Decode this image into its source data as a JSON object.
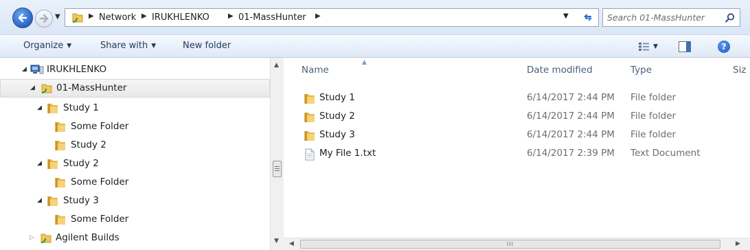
{
  "address_bar": {
    "breadcrumbs": [
      "Network",
      "IRUKHLENKO",
      "01-MassHunter"
    ],
    "search_placeholder": "Search 01-MassHunter"
  },
  "toolbar": {
    "organize_label": "Organize",
    "share_with_label": "Share with",
    "new_folder_label": "New folder"
  },
  "nav_tree": [
    {
      "label": "IRUKHLENKO",
      "level": 0,
      "icon": "network-computer-icon",
      "state": "expanded"
    },
    {
      "label": "01-MassHunter",
      "level": 1,
      "icon": "folder-shortcut-icon",
      "state": "expanded",
      "selected": true
    },
    {
      "label": "Study 1",
      "level": 2,
      "icon": "folder-icon",
      "state": "expanded"
    },
    {
      "label": "Some Folder",
      "level": 3,
      "icon": "folder-icon",
      "state": "none"
    },
    {
      "label": "Study 2",
      "level": 3,
      "icon": "folder-icon",
      "state": "none"
    },
    {
      "label": "Study 2",
      "level": 2,
      "icon": "folder-icon",
      "state": "expanded"
    },
    {
      "label": "Some Folder",
      "level": 3,
      "icon": "folder-icon",
      "state": "none"
    },
    {
      "label": "Study 3",
      "level": 2,
      "icon": "folder-icon",
      "state": "expanded"
    },
    {
      "label": "Some Folder",
      "level": 3,
      "icon": "folder-icon",
      "state": "none"
    },
    {
      "label": "Agilent Builds",
      "level": 1,
      "icon": "folder-shortcut-icon",
      "state": "collapsed"
    }
  ],
  "content": {
    "columns": {
      "name": "Name",
      "date_modified": "Date modified",
      "type": "Type",
      "size": "Siz"
    },
    "files": [
      {
        "name": "Study 1",
        "date": "6/14/2017 2:44 PM",
        "type": "File folder",
        "icon": "folder-icon"
      },
      {
        "name": "Study 2",
        "date": "6/14/2017 2:44 PM",
        "type": "File folder",
        "icon": "folder-icon"
      },
      {
        "name": "Study 3",
        "date": "6/14/2017 2:44 PM",
        "type": "File folder",
        "icon": "folder-icon"
      },
      {
        "name": "My File 1.txt",
        "date": "6/14/2017 2:39 PM",
        "type": "Text Document",
        "icon": "text-file-icon"
      }
    ]
  },
  "colors": {
    "accent": "#1d57c1",
    "toolbar_text": "#1e395b",
    "folder": "#e8b84a"
  }
}
